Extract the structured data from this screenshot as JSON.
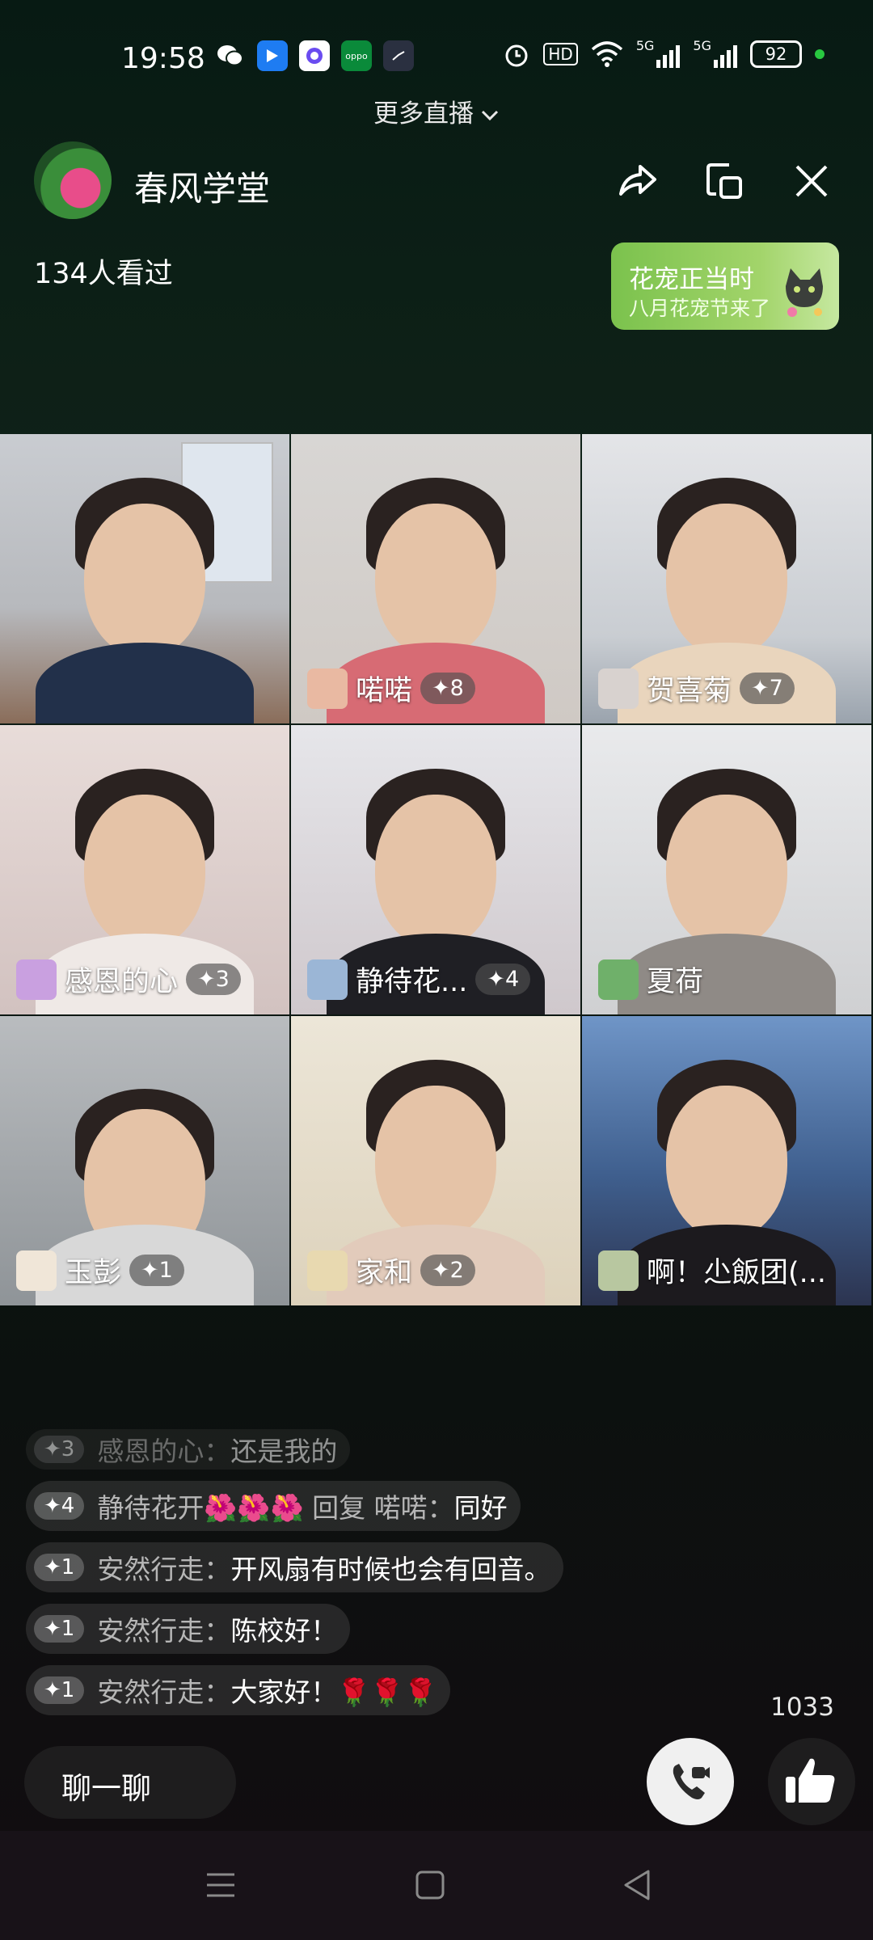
{
  "status_bar": {
    "time": "19:58",
    "network": "5G",
    "battery": "92",
    "hd_label": "HD"
  },
  "more_live": "更多直播",
  "channel": {
    "name": "春风学堂",
    "viewers": "134人看过"
  },
  "promo": {
    "title": "花宠正当时",
    "subtitle": "八月花宠节来了"
  },
  "tiles": [
    {
      "name": "",
      "level": ""
    },
    {
      "name": "喏喏",
      "level": "✦8"
    },
    {
      "name": "贺喜菊",
      "level": "✦7"
    },
    {
      "name": "感恩的心",
      "level": "✦3"
    },
    {
      "name": "静待花...",
      "level": "✦4"
    },
    {
      "name": "夏荷",
      "level": ""
    },
    {
      "name": "玉彭",
      "level": "✦1"
    },
    {
      "name": "家和",
      "level": "✦2"
    },
    {
      "name": "啊！尐飯团(...",
      "level": ""
    }
  ],
  "chat": [
    {
      "level": "✦3",
      "user": "感恩的心：",
      "text": "还是我的"
    },
    {
      "level": "✦4",
      "user": "静待花开🌺🌺🌺 回复 喏喏：",
      "text": "同好"
    },
    {
      "level": "✦1",
      "user": "安然行走：",
      "text": "开风扇有时候也会有回音。"
    },
    {
      "level": "✦1",
      "user": "安然行走：",
      "text": "陈校好！"
    },
    {
      "level": "✦1",
      "user": "安然行走：",
      "text": "大家好！🌹🌹🌹"
    }
  ],
  "like_count": "1033",
  "chat_input": "聊一聊",
  "colors": {
    "promo_green": "#8cc95a",
    "online_dot": "#28c840"
  }
}
